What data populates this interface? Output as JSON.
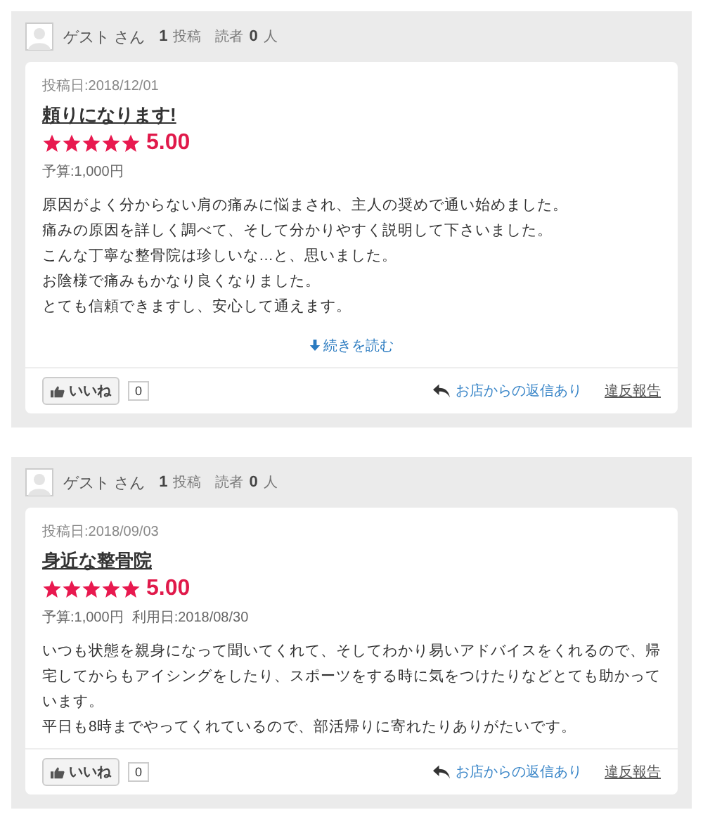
{
  "reviews": [
    {
      "author": "ゲスト さん",
      "posts_count": "1",
      "posts_label": "投稿",
      "readers_label": "読者",
      "readers_count": "0",
      "readers_unit": "人",
      "posted": "投稿日:2018/12/01",
      "title": "頼りになります!",
      "stars": 5,
      "score": "5.00",
      "meta": [
        "予算:1,000円"
      ],
      "body": [
        "原因がよく分からない肩の痛みに悩まされ、主人の奨めで通い始めました。",
        "痛みの原因を詳しく調べて、そして分かりやすく説明して下さいました。",
        "こんな丁寧な整骨院は珍しいな…と、思いました。",
        "お陰様で痛みもかなり良くなりました。",
        "とても信頼できますし、安心して通えます。"
      ],
      "more": "続きを読む",
      "like": "いいね",
      "like_count": "0",
      "reply": "お店からの返信あり",
      "report": "違反報告"
    },
    {
      "author": "ゲスト さん",
      "posts_count": "1",
      "posts_label": "投稿",
      "readers_label": "読者",
      "readers_count": "0",
      "readers_unit": "人",
      "posted": "投稿日:2018/09/03",
      "title": "身近な整骨院",
      "stars": 5,
      "score": "5.00",
      "meta": [
        "予算:1,000円",
        "利用日:2018/08/30"
      ],
      "body": [
        "いつも状態を親身になって聞いてくれて、そしてわかり易いアドバイスをくれるので、帰宅してからもアイシングをしたり、スポーツをする時に気をつけたりなどとても助かっています。",
        "平日も8時までやってくれているので、部活帰りに寄れたりありがたいです。"
      ],
      "like": "いいね",
      "like_count": "0",
      "reply": "お店からの返信あり",
      "report": "違反報告"
    }
  ]
}
